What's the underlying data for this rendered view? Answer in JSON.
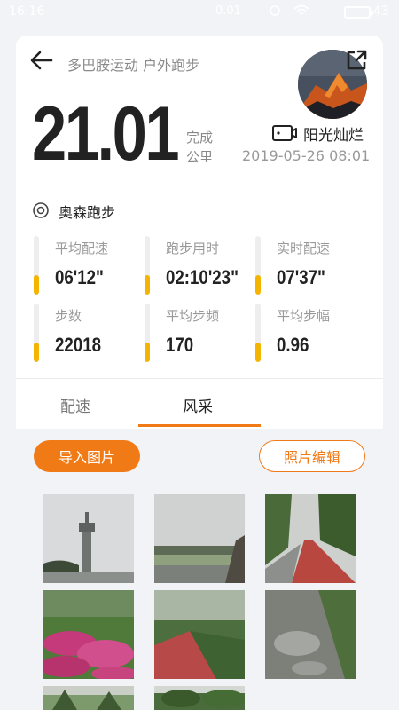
{
  "status_bar": {
    "time": "16:16",
    "net_speed": "0.01",
    "battery": "43"
  },
  "header": {
    "breadcrumb": "多巴胺运动 户外跑步",
    "distance": "21.01",
    "distance_label_line1": "完成",
    "distance_label_line2": "公里",
    "username": "阳光灿烂",
    "datetime": "2019-05-26 08:01"
  },
  "course": {
    "name": "奥森跑步"
  },
  "stats": [
    {
      "label": "平均配速",
      "value": "06'12\"",
      "level": 0.33
    },
    {
      "label": "跑步用时",
      "value": "02:10'23\"",
      "level": 0.33
    },
    {
      "label": "实时配速",
      "value": "07'37\"",
      "level": 0.33
    },
    {
      "label": "步数",
      "value": "22018",
      "level": 0.33
    },
    {
      "label": "平均步频",
      "value": "170",
      "level": 0.33
    },
    {
      "label": "平均步幅",
      "value": "0.96",
      "level": 0.33
    }
  ],
  "tabs": [
    {
      "label": "配速",
      "active": false
    },
    {
      "label": "风采",
      "active": true
    }
  ],
  "photos": {
    "import_label": "导入图片",
    "edit_label": "照片编辑"
  },
  "colors": {
    "accent": "#f07a16",
    "stat_bar": "#f4b400",
    "background": "#f2f3f7"
  }
}
